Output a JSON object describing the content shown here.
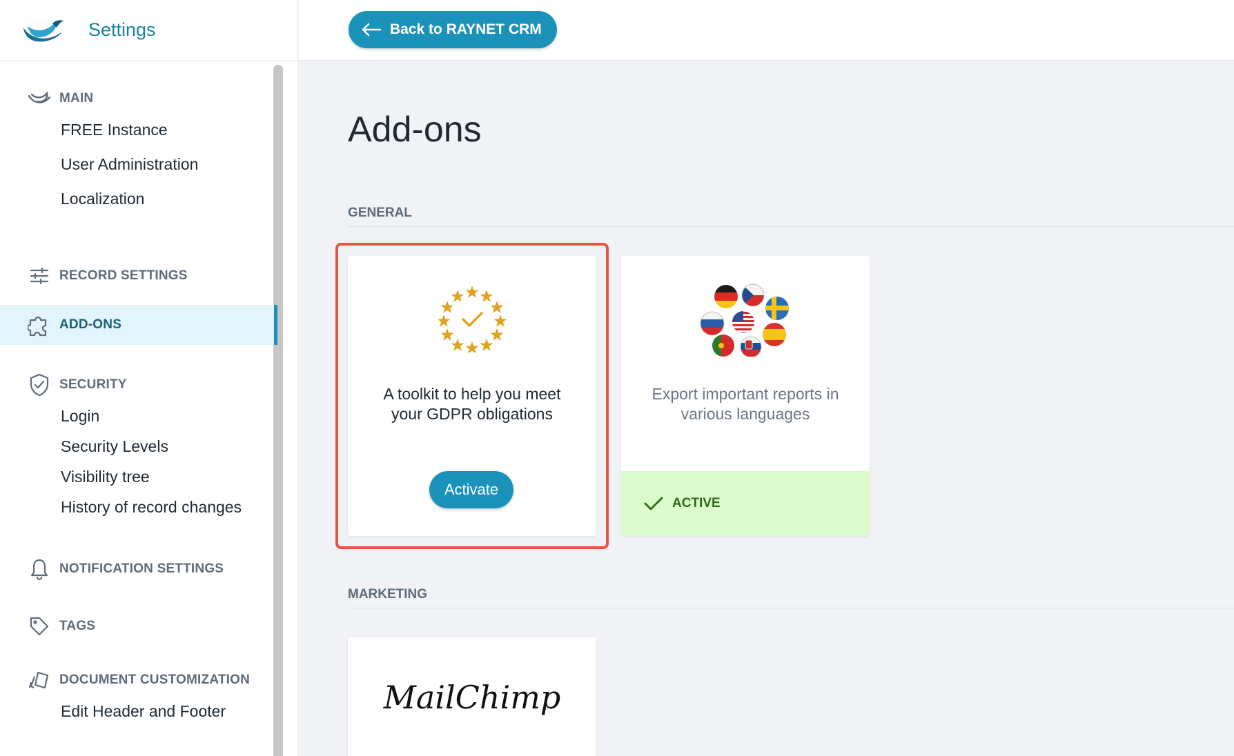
{
  "app": {
    "title": "Settings"
  },
  "topbar": {
    "back_label": "Back to RAYNET CRM"
  },
  "sidebar": {
    "sections": [
      {
        "label": "MAIN",
        "icon": "raynet-bird-icon",
        "items": [
          "FREE Instance",
          "User Administration",
          "Localization"
        ]
      },
      {
        "label": "RECORD SETTINGS",
        "icon": "sliders-icon",
        "items": []
      },
      {
        "label": "ADD-ONS",
        "icon": "puzzle-icon",
        "active": true,
        "items": []
      },
      {
        "label": "SECURITY",
        "icon": "shield-check-icon",
        "items": [
          "Login",
          "Security Levels",
          "Visibility tree",
          "History of record changes"
        ]
      },
      {
        "label": "NOTIFICATION SETTINGS",
        "icon": "bell-icon",
        "items": []
      },
      {
        "label": "TAGS",
        "icon": "tag-icon",
        "items": []
      },
      {
        "label": "DOCUMENT CUSTOMIZATION",
        "icon": "document-customization-icon",
        "items": [
          "Edit Header and Footer"
        ]
      }
    ]
  },
  "main": {
    "title": "Add-ons",
    "categories": [
      {
        "label": "GENERAL",
        "cards": [
          {
            "icon": "eu-stars-check-icon",
            "description": "A toolkit to help you meet your GDPR obligations",
            "action": "Activate"
          },
          {
            "icon": "language-flags-icon",
            "description": "Export important reports in various languages",
            "status": "ACTIVE"
          }
        ]
      },
      {
        "label": "MARKETING",
        "cards": [
          {
            "icon": "mailchimp-logo",
            "logo_text": "MailChimp"
          }
        ]
      }
    ]
  },
  "colors": {
    "accent": "#1b92b9",
    "highlight": "#e8553f",
    "active_bg": "#dcfbcc",
    "active_text": "#2f6a12"
  }
}
